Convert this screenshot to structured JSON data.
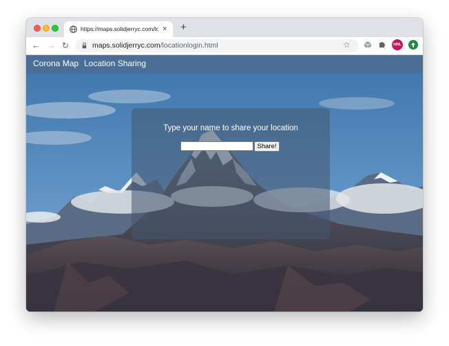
{
  "browser": {
    "tab_title": "https://maps.solidjerryc.com/locationlogin.html",
    "tab_close": "×",
    "new_tab": "+",
    "url_host": "maps.solidjerryc.com",
    "url_path": "/locationlogin.html",
    "back_glyph": "←",
    "forward_glyph": "→",
    "reload_glyph": "↻",
    "star_glyph": "☆",
    "avatar_text": "HINL"
  },
  "navbar": {
    "items": [
      "Corona Map",
      "Location Sharing"
    ]
  },
  "panel": {
    "prompt": "Type your name to share your location",
    "input_value": "",
    "button_label": "Share!"
  },
  "colors": {
    "navbar_bg": "#4c6e94",
    "panel_bg": "#465870",
    "avatar": "#c2185b",
    "sky": "#4f86bb"
  },
  "icons": [
    "globe-icon",
    "close-icon",
    "plus-icon",
    "back-arrow-icon",
    "forward-arrow-icon",
    "reload-icon",
    "lock-icon",
    "star-icon",
    "cube-extension-icon",
    "puzzle-icon",
    "profile-avatar",
    "green-extension-icon"
  ]
}
